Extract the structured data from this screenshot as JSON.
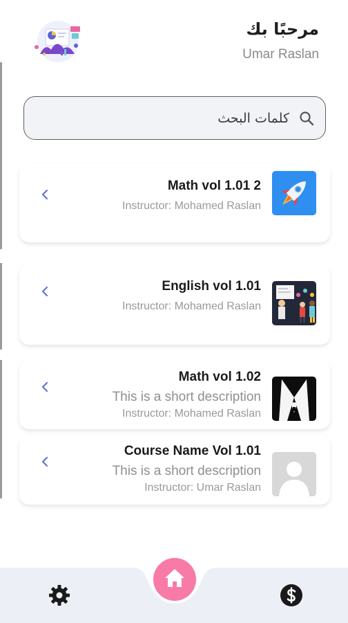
{
  "header": {
    "greeting": "مرحبًا بك",
    "username": "Umar Raslan"
  },
  "search": {
    "placeholder": "كلمات البحث"
  },
  "courses": [
    {
      "title": "Math vol 1.01 2",
      "instructor": "Instructor: Mohamed Raslan",
      "thumbnail": "rocket-thumbnail"
    },
    {
      "title": "English vol 1.01",
      "instructor": "Instructor: Mohamed Raslan",
      "thumbnail": "classroom-thumbnail"
    },
    {
      "title": "Math vol 1.02",
      "description": "This is a short description",
      "instructor": "Instructor: Mohamed Raslan",
      "thumbnail": "suit-thumbnail"
    },
    {
      "title": "Course Name Vol 1.01",
      "description": "This is a short description",
      "instructor": "Instructor: Umar Raslan",
      "thumbnail": "placeholder-person-thumbnail"
    }
  ],
  "bottom_nav": {
    "icons": [
      "gear-icon",
      "home-icon",
      "dollar-icon"
    ]
  },
  "colors": {
    "accent": "#6a6fd6",
    "home_button": "#f77ba6",
    "nav_background": "#eceff6",
    "search_background": "#f2f3f6"
  }
}
